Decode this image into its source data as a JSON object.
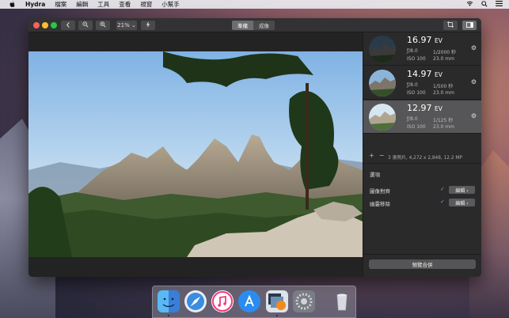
{
  "menubar": {
    "apple_icon": "apple-icon",
    "app_name": "Hydra",
    "items": [
      "檔案",
      "編輯",
      "工具",
      "查看",
      "視窗",
      "小幫手"
    ],
    "status_icons": [
      "wifi-icon",
      "search-icon",
      "list-icon"
    ]
  },
  "toolbar": {
    "zoom_label": "21% ⌄",
    "segments": [
      "準備",
      "成像"
    ],
    "active_segment": "準備"
  },
  "brackets": [
    {
      "ev": "16.97",
      "ev_unit": "EV",
      "aperture": "ƒ/8.0",
      "shutter": "1/2000 秒",
      "iso": "ISO 100",
      "focal": "23.0 mm"
    },
    {
      "ev": "14.97",
      "ev_unit": "EV",
      "aperture": "ƒ/8.0",
      "shutter": "1/500 秒",
      "iso": "ISO 100",
      "focal": "23.0 mm"
    },
    {
      "ev": "12.97",
      "ev_unit": "EV",
      "aperture": "ƒ/8.0",
      "shutter": "1/125 秒",
      "iso": "ISO 100",
      "focal": "23.0 mm"
    }
  ],
  "sidebar": {
    "add_label": "+",
    "remove_label": "−",
    "summary": "3 張照片, 4,272 x 2,848, 12.2 MP",
    "options_title": "選項",
    "options": [
      {
        "label": "圖像對齊",
        "edit_label": "編輯 ›"
      },
      {
        "label": "幽靈移除",
        "edit_label": "編輯 ›"
      }
    ],
    "merge_label": "預覽合併"
  },
  "dock": {
    "apps": [
      "finder-icon",
      "safari-icon",
      "itunes-icon",
      "app-store-icon",
      "hydra-icon",
      "system-preferences-icon",
      "trash-icon"
    ]
  },
  "colors": {
    "accent_check": "#5aa0f5",
    "window_bg": "#2b2b2c",
    "selected_bracket": "#565658"
  }
}
